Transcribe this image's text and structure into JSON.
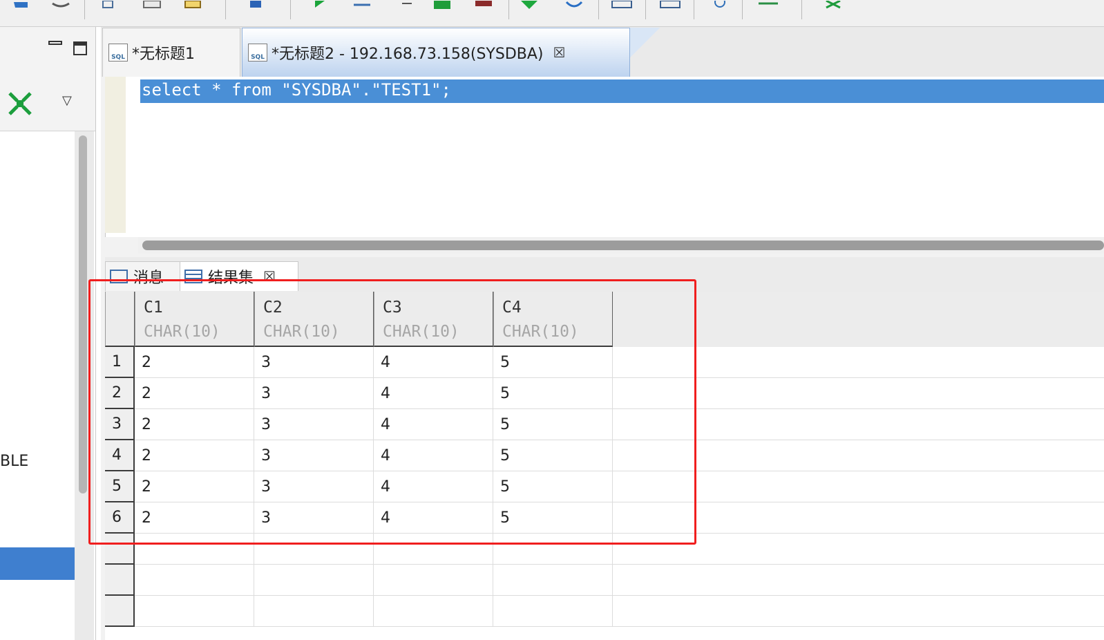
{
  "toolbar": {
    "icons": [
      "undo-icon",
      "redo-icon",
      "copy-icon",
      "paste-icon",
      "open-icon",
      "home-icon",
      "run-icon",
      "step-icon",
      "minus-icon",
      "run-file-icon",
      "stop-icon",
      "down-arrow-icon",
      "refresh-icon",
      "zoom-icon",
      "explain-icon",
      "search-icon",
      "export-icon",
      "pin-icon"
    ]
  },
  "left_panel": {
    "minimize_label": "▭",
    "maximize_label": "◻",
    "menu_glyph": "▽",
    "item_label": "BLE"
  },
  "tabs": [
    {
      "label": "*无标题1",
      "icon": "sql-file-icon"
    },
    {
      "label": "*无标题2 - 192.168.73.158(SYSDBA)",
      "icon": "sql-file-icon",
      "close": "☒"
    }
  ],
  "editor": {
    "code": "select * from \"SYSDBA\".\"TEST1\";"
  },
  "result_tabs": [
    {
      "label": "消息",
      "icon": "message-icon"
    },
    {
      "label": "结果集",
      "icon": "table-icon",
      "close": "☒"
    }
  ],
  "grid": {
    "columns": [
      {
        "name": "C1",
        "type": "CHAR(10)"
      },
      {
        "name": "C2",
        "type": "CHAR(10)"
      },
      {
        "name": "C3",
        "type": "CHAR(10)"
      },
      {
        "name": "C4",
        "type": "CHAR(10)"
      }
    ],
    "rows": [
      {
        "num": "1",
        "cells": [
          "2",
          "3",
          "4",
          "5"
        ]
      },
      {
        "num": "2",
        "cells": [
          "2",
          "3",
          "4",
          "5"
        ]
      },
      {
        "num": "3",
        "cells": [
          "2",
          "3",
          "4",
          "5"
        ]
      },
      {
        "num": "4",
        "cells": [
          "2",
          "3",
          "4",
          "5"
        ]
      },
      {
        "num": "5",
        "cells": [
          "2",
          "3",
          "4",
          "5"
        ]
      },
      {
        "num": "6",
        "cells": [
          "2",
          "3",
          "4",
          "5"
        ]
      }
    ]
  },
  "colors": {
    "highlight": "#4a8fd6",
    "annotation_box": "#f01e1e",
    "selection": "#3f7fcf"
  }
}
